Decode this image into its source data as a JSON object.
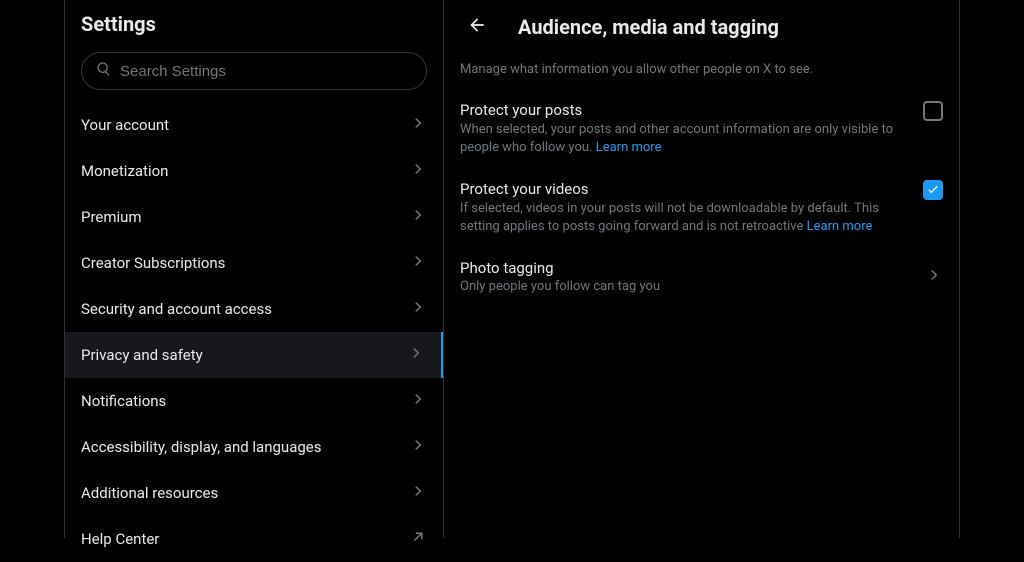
{
  "sidebar": {
    "title": "Settings",
    "search_placeholder": "Search Settings",
    "items": [
      {
        "label": "Your account",
        "kind": "chev"
      },
      {
        "label": "Monetization",
        "kind": "chev"
      },
      {
        "label": "Premium",
        "kind": "chev"
      },
      {
        "label": "Creator Subscriptions",
        "kind": "chev"
      },
      {
        "label": "Security and account access",
        "kind": "chev"
      },
      {
        "label": "Privacy and safety",
        "kind": "chev",
        "active": true
      },
      {
        "label": "Notifications",
        "kind": "chev"
      },
      {
        "label": "Accessibility, display, and languages",
        "kind": "chev"
      },
      {
        "label": "Additional resources",
        "kind": "chev"
      },
      {
        "label": "Help Center",
        "kind": "ext"
      }
    ]
  },
  "detail": {
    "title": "Audience, media and tagging",
    "description": "Manage what information you allow other people on X to see.",
    "protect_posts": {
      "title": "Protect your posts",
      "desc": "When selected, your posts and other account information are only visible to people who follow you. ",
      "learn": "Learn more",
      "checked": false
    },
    "protect_videos": {
      "title": "Protect your videos",
      "desc": "If selected, videos in your posts will not be downloadable by default. This setting applies to posts going forward and is not retroactive ",
      "learn": "Learn more",
      "checked": true
    },
    "photo_tagging": {
      "title": "Photo tagging",
      "desc": "Only people you follow can tag you"
    }
  }
}
